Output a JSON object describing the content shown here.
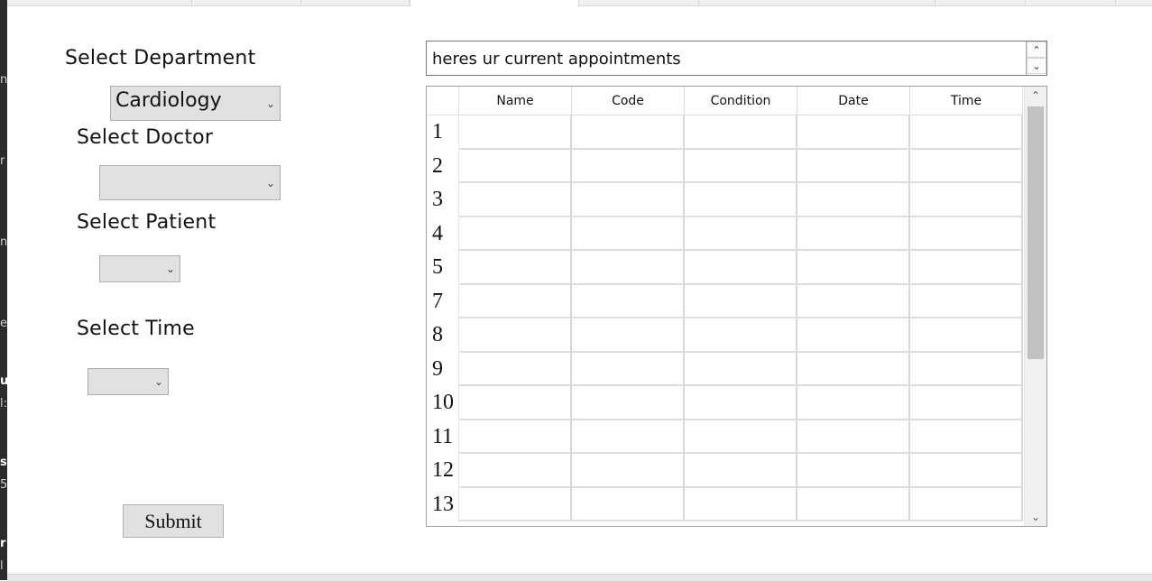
{
  "background_window": {
    "side_text": [
      "n",
      "r",
      "n",
      "e",
      "u",
      "l:",
      "s",
      "5",
      "r",
      "l"
    ]
  },
  "tabs": [
    {
      "label": ""
    },
    {
      "label": ""
    },
    {
      "label": ""
    },
    {
      "label": "",
      "active": true
    },
    {
      "label": ""
    },
    {
      "label": ""
    },
    {
      "label": ""
    },
    {
      "label": ""
    }
  ],
  "form": {
    "department_label": "Select Department",
    "department_value": "Cardiology",
    "doctor_label": "Select Doctor",
    "doctor_value": "",
    "patient_label": "Select Patient",
    "patient_value": "",
    "time_label": "Select Time",
    "time_value": "",
    "submit_label": "Submit"
  },
  "appointments": {
    "spinbox_text": "heres ur current appointments",
    "columns": [
      "Name",
      "Code",
      "Condition",
      "Date",
      "Time"
    ],
    "row_numbers": [
      "1",
      "2",
      "3",
      "4",
      "5",
      "7",
      "8",
      "9",
      "10",
      "11",
      "12",
      "13"
    ]
  },
  "icons": {
    "dropdown_arrow": "chevron-down-icon",
    "spin_up": "chevron-up-icon",
    "spin_down": "chevron-down-icon",
    "chevron_down_glyph": "⌄",
    "chevron_up_glyph": "⌃"
  },
  "colors": {
    "combo_bg": "#e1e1e1",
    "border": "#adadad",
    "scroll_thumb": "#c2c2c2"
  }
}
